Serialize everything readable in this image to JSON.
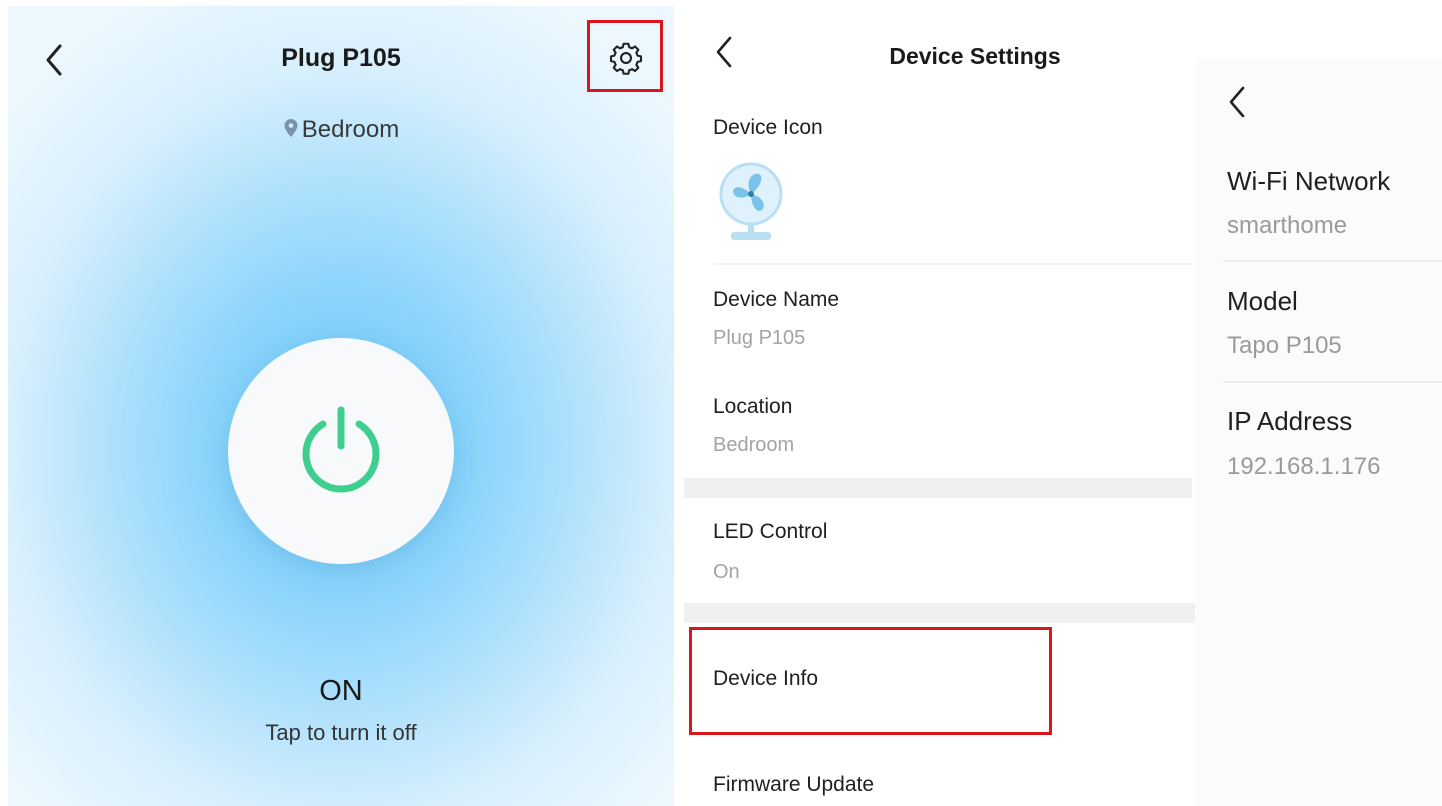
{
  "plug_screen": {
    "title": "Plug P105",
    "location": "Bedroom",
    "power_state": "ON",
    "hint": "Tap to turn it off",
    "accent_color": "#3ecf8e",
    "highlight_color": "#d9161b"
  },
  "settings_screen": {
    "title": "Device Settings",
    "device_icon_label": "Device Icon",
    "device_name_label": "Device Name",
    "device_name_value": "Plug P105",
    "location_label": "Location",
    "location_value": "Bedroom",
    "led_label": "LED Control",
    "led_value": "On",
    "device_info_label": "Device Info",
    "firmware_label": "Firmware Update"
  },
  "info_screen": {
    "wifi_label": "Wi-Fi Network",
    "wifi_value": "smarthome",
    "model_label": "Model",
    "model_value": "Tapo P105",
    "ip_label": "IP Address",
    "ip_value": "192.168.1.176"
  }
}
